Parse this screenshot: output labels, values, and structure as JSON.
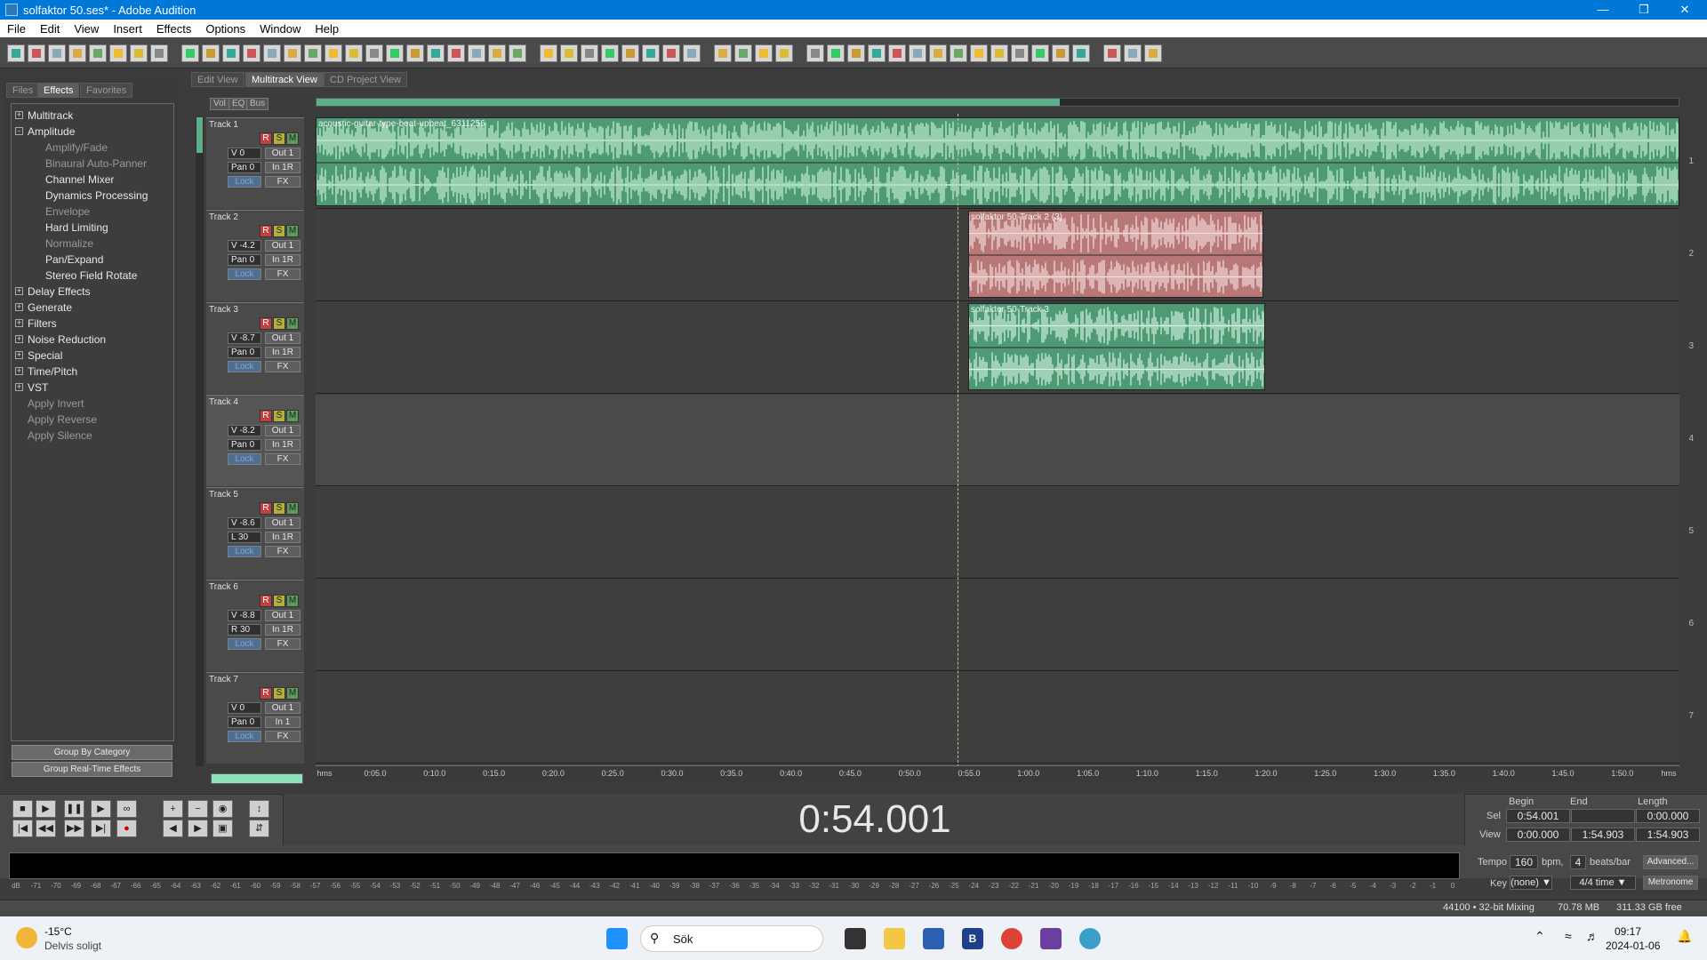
{
  "window": {
    "title": "solfaktor 50.ses* - Adobe Audition"
  },
  "menu": [
    "File",
    "Edit",
    "View",
    "Insert",
    "Effects",
    "Options",
    "Window",
    "Help"
  ],
  "left_panel": {
    "tabs": [
      "Files",
      "Effects",
      "Favorites"
    ],
    "active_tab": "Effects",
    "tree": [
      {
        "label": "Multitrack",
        "level": 0,
        "expander": "+",
        "dim": false
      },
      {
        "label": "Amplitude",
        "level": 0,
        "expander": "-",
        "dim": false
      },
      {
        "label": "Amplify/Fade",
        "level": 1,
        "dim": true
      },
      {
        "label": "Binaural Auto-Panner",
        "level": 1,
        "dim": true
      },
      {
        "label": "Channel Mixer",
        "level": 1,
        "dim": false
      },
      {
        "label": "Dynamics Processing",
        "level": 1,
        "dim": false
      },
      {
        "label": "Envelope",
        "level": 1,
        "dim": true
      },
      {
        "label": "Hard Limiting",
        "level": 1,
        "dim": false
      },
      {
        "label": "Normalize",
        "level": 1,
        "dim": true
      },
      {
        "label": "Pan/Expand",
        "level": 1,
        "dim": false
      },
      {
        "label": "Stereo Field Rotate",
        "level": 1,
        "dim": false
      },
      {
        "label": "Delay Effects",
        "level": 0,
        "expander": "+",
        "dim": false
      },
      {
        "label": "Generate",
        "level": 0,
        "expander": "+",
        "dim": false
      },
      {
        "label": "Filters",
        "level": 0,
        "expander": "+",
        "dim": false
      },
      {
        "label": "Noise Reduction",
        "level": 0,
        "expander": "+",
        "dim": false
      },
      {
        "label": "Special",
        "level": 0,
        "expander": "+",
        "dim": false
      },
      {
        "label": "Time/Pitch",
        "level": 0,
        "expander": "+",
        "dim": false
      },
      {
        "label": "VST",
        "level": 0,
        "expander": "+",
        "dim": false
      },
      {
        "label": "Apply Invert",
        "level": 0,
        "dim": true
      },
      {
        "label": "Apply Reverse",
        "level": 0,
        "dim": true
      },
      {
        "label": "Apply Silence",
        "level": 0,
        "dim": true
      }
    ],
    "buttons": [
      "Group By Category",
      "Group Real-Time Effects"
    ]
  },
  "view_tabs": [
    "Edit View",
    "Multitrack View",
    "CD Project View"
  ],
  "active_view": "Multitrack View",
  "track_tabs": [
    "Vol",
    "EQ",
    "Bus"
  ],
  "tracks": [
    {
      "name": "Track 1",
      "vol": "V 0",
      "out": "Out 1",
      "pan": "Pan 0",
      "in": "In 1R",
      "lock": "Lock",
      "fx": "FX",
      "r": "R",
      "s": "S",
      "m": "M",
      "lane_num": "1"
    },
    {
      "name": "Track 2",
      "vol": "V -4.2",
      "out": "Out 1",
      "pan": "Pan 0",
      "in": "In 1R",
      "lock": "Lock",
      "fx": "FX",
      "r": "R",
      "s": "S",
      "m": "M",
      "lane_num": "2"
    },
    {
      "name": "Track 3",
      "vol": "V -8.7",
      "out": "Out 1",
      "pan": "Pan 0",
      "in": "In 1R",
      "lock": "Lock",
      "fx": "FX",
      "r": "R",
      "s": "S",
      "m": "M",
      "lane_num": "3"
    },
    {
      "name": "Track 4",
      "vol": "V -8.2",
      "out": "Out 1",
      "pan": "Pan 0",
      "in": "In 1R",
      "lock": "Lock",
      "fx": "FX",
      "r": "R",
      "s": "S",
      "m": "M",
      "lane_num": "4"
    },
    {
      "name": "Track 5",
      "vol": "V -8.6",
      "out": "Out 1",
      "pan": "L 30",
      "in": "In 1R",
      "lock": "Lock",
      "fx": "FX",
      "r": "R",
      "s": "S",
      "m": "M",
      "lane_num": "5"
    },
    {
      "name": "Track 6",
      "vol": "V -8.8",
      "out": "Out 1",
      "pan": "R 30",
      "in": "In 1R",
      "lock": "Lock",
      "fx": "FX",
      "r": "R",
      "s": "S",
      "m": "M",
      "lane_num": "6"
    },
    {
      "name": "Track 7",
      "vol": "V 0",
      "out": "Out 1",
      "pan": "Pan 0",
      "in": "In 1",
      "lock": "Lock",
      "fx": "FX",
      "r": "R",
      "s": "S",
      "m": "M",
      "lane_num": "7"
    }
  ],
  "clips": [
    {
      "label": "acoustic-guitar-type-beat-upbeat_6311256",
      "track": 1,
      "color": "#4e9a74"
    },
    {
      "label": "solfaktor 50-Track 2 (3)",
      "track": 2,
      "color": "#b87878"
    },
    {
      "label": "solfaktor 50-Track 3",
      "track": 3,
      "color": "#4e9a74"
    }
  ],
  "ruler": {
    "unit_left": "hms",
    "unit_right": "hms",
    "ticks": [
      "0:05.0",
      "0:10.0",
      "0:15.0",
      "0:20.0",
      "0:25.0",
      "0:30.0",
      "0:35.0",
      "0:40.0",
      "0:45.0",
      "0:50.0",
      "0:55.0",
      "1:00.0",
      "1:05.0",
      "1:10.0",
      "1:15.0",
      "1:20.0",
      "1:25.0",
      "1:30.0",
      "1:35.0",
      "1:40.0",
      "1:45.0",
      "1:50.0"
    ]
  },
  "transport": {
    "time": "0:54.001",
    "sel_view": {
      "headers": {
        "begin": "Begin",
        "end": "End",
        "length": "Length"
      },
      "sel": {
        "label": "Sel",
        "begin": "0:54.001",
        "end": "",
        "length": "0:00.000"
      },
      "view": {
        "label": "View",
        "begin": "0:00.000",
        "end": "1:54.903",
        "length": "1:54.903"
      }
    },
    "tempo": {
      "label": "Tempo",
      "value": "160",
      "unit": "bpm,",
      "beats": "4",
      "beats_unit": "beats/bar",
      "advanced": "Advanced..."
    },
    "key": {
      "label": "Key",
      "value": "(none)",
      "time_sig": "4/4 time",
      "metronome": "Metronome"
    }
  },
  "meter_scale": [
    "dB",
    "-71",
    "-70",
    "-69",
    "-68",
    "-67",
    "-66",
    "-65",
    "-64",
    "-63",
    "-62",
    "-61",
    "-60",
    "-59",
    "-58",
    "-57",
    "-56",
    "-55",
    "-54",
    "-53",
    "-52",
    "-51",
    "-50",
    "-49",
    "-48",
    "-47",
    "-46",
    "-45",
    "-44",
    "-43",
    "-42",
    "-41",
    "-40",
    "-39",
    "-38",
    "-37",
    "-36",
    "-35",
    "-34",
    "-33",
    "-32",
    "-31",
    "-30",
    "-29",
    "-28",
    "-27",
    "-26",
    "-25",
    "-24",
    "-23",
    "-22",
    "-21",
    "-20",
    "-19",
    "-18",
    "-17",
    "-16",
    "-15",
    "-14",
    "-13",
    "-12",
    "-11",
    "-10",
    "-9",
    "-8",
    "-7",
    "-6",
    "-5",
    "-4",
    "-3",
    "-2",
    "-1",
    "0"
  ],
  "status": {
    "format": "44100 • 32-bit Mixing",
    "mem": "70.78 MB",
    "free": "311.33 GB free"
  },
  "taskbar": {
    "weather_temp": "-15°C",
    "weather_desc": "Delvis soligt",
    "search": "Sök",
    "time": "09:17",
    "date": "2024-01-06"
  }
}
